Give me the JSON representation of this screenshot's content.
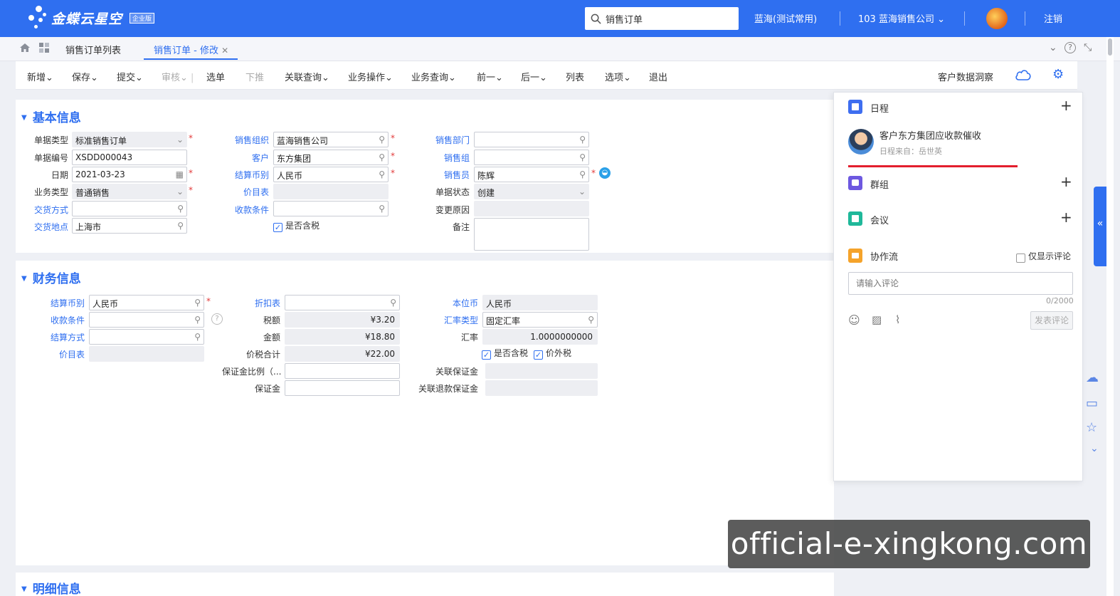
{
  "header": {
    "logo_text": "金蝶云星空",
    "logo_badge": "企业版",
    "search_value": "销售订单",
    "env": "蓝海(测试常用)",
    "org": "103 蓝海销售公司",
    "logout": "注销"
  },
  "tabs": [
    {
      "label": "销售订单列表"
    },
    {
      "label": "销售订单 - 修改"
    }
  ],
  "toolbar": {
    "items": [
      "新增",
      "保存",
      "提交",
      "审核",
      "选单",
      "下推",
      "关联查询",
      "业务操作",
      "业务查询",
      "前一",
      "后一",
      "列表",
      "选项",
      "退出"
    ],
    "right_label": "客户数据洞察"
  },
  "basic": {
    "title": "基本信息",
    "doc_type_label": "单据类型",
    "doc_type": "标准销售订单",
    "doc_no_label": "单据编号",
    "doc_no": "XSDD000043",
    "date_label": "日期",
    "date": "2021-03-23",
    "biz_type_label": "业务类型",
    "biz_type": "普通销售",
    "delivery_method_label": "交货方式",
    "delivery_method": "",
    "delivery_place_label": "交货地点",
    "delivery_place": "上海市",
    "sales_org_label": "销售组织",
    "sales_org": "蓝海销售公司",
    "customer_label": "客户",
    "customer": "东方集团",
    "settle_currency_label": "结算币别",
    "settle_currency": "人民币",
    "price_list_label": "价目表",
    "payment_terms_label": "收款条件",
    "tax_included_label": "是否含税",
    "sales_dept_label": "销售部门",
    "sales_group_label": "销售组",
    "salesman_label": "销售员",
    "salesman": "陈辉",
    "doc_status_label": "单据状态",
    "doc_status": "创建",
    "change_reason_label": "变更原因",
    "remark_label": "备注"
  },
  "finance": {
    "title": "财务信息",
    "settle_currency_label": "结算币别",
    "settle_currency": "人民币",
    "payment_terms_label": "收款条件",
    "settle_method_label": "结算方式",
    "price_list_label": "价目表",
    "discount_label": "折扣表",
    "tax_label": "税额",
    "tax": "¥3.20",
    "amount_label": "金额",
    "amount": "¥18.80",
    "total_label": "价税合计",
    "total": "¥22.00",
    "deposit_ratio_label": "保证金比例（...",
    "deposit_label": "保证金",
    "base_currency_label": "本位币",
    "base_currency": "人民币",
    "rate_type_label": "汇率类型",
    "rate_type": "固定汇率",
    "rate_label": "汇率",
    "rate": "1.0000000000",
    "tax_included_label": "是否含税",
    "extra_tax_label": "价外税",
    "linked_deposit_label": "关联保证金",
    "linked_refund_label": "关联退款保证金"
  },
  "detail": {
    "title": "明细信息"
  },
  "side": {
    "schedule": "日程",
    "schedule_item": "客户东方集团应收款催收",
    "schedule_source": "日程来自：岳世英",
    "group": "群组",
    "meeting": "会议",
    "flow": "协作流",
    "only_comments": "仅显示评论",
    "comment_placeholder": "请输入评论",
    "counter": "0/2000",
    "send": "发表评论"
  },
  "watermark": "official-e-xingkong.com",
  "colors": {
    "brand": "#2f6ff0",
    "required": "#e23b3b"
  }
}
